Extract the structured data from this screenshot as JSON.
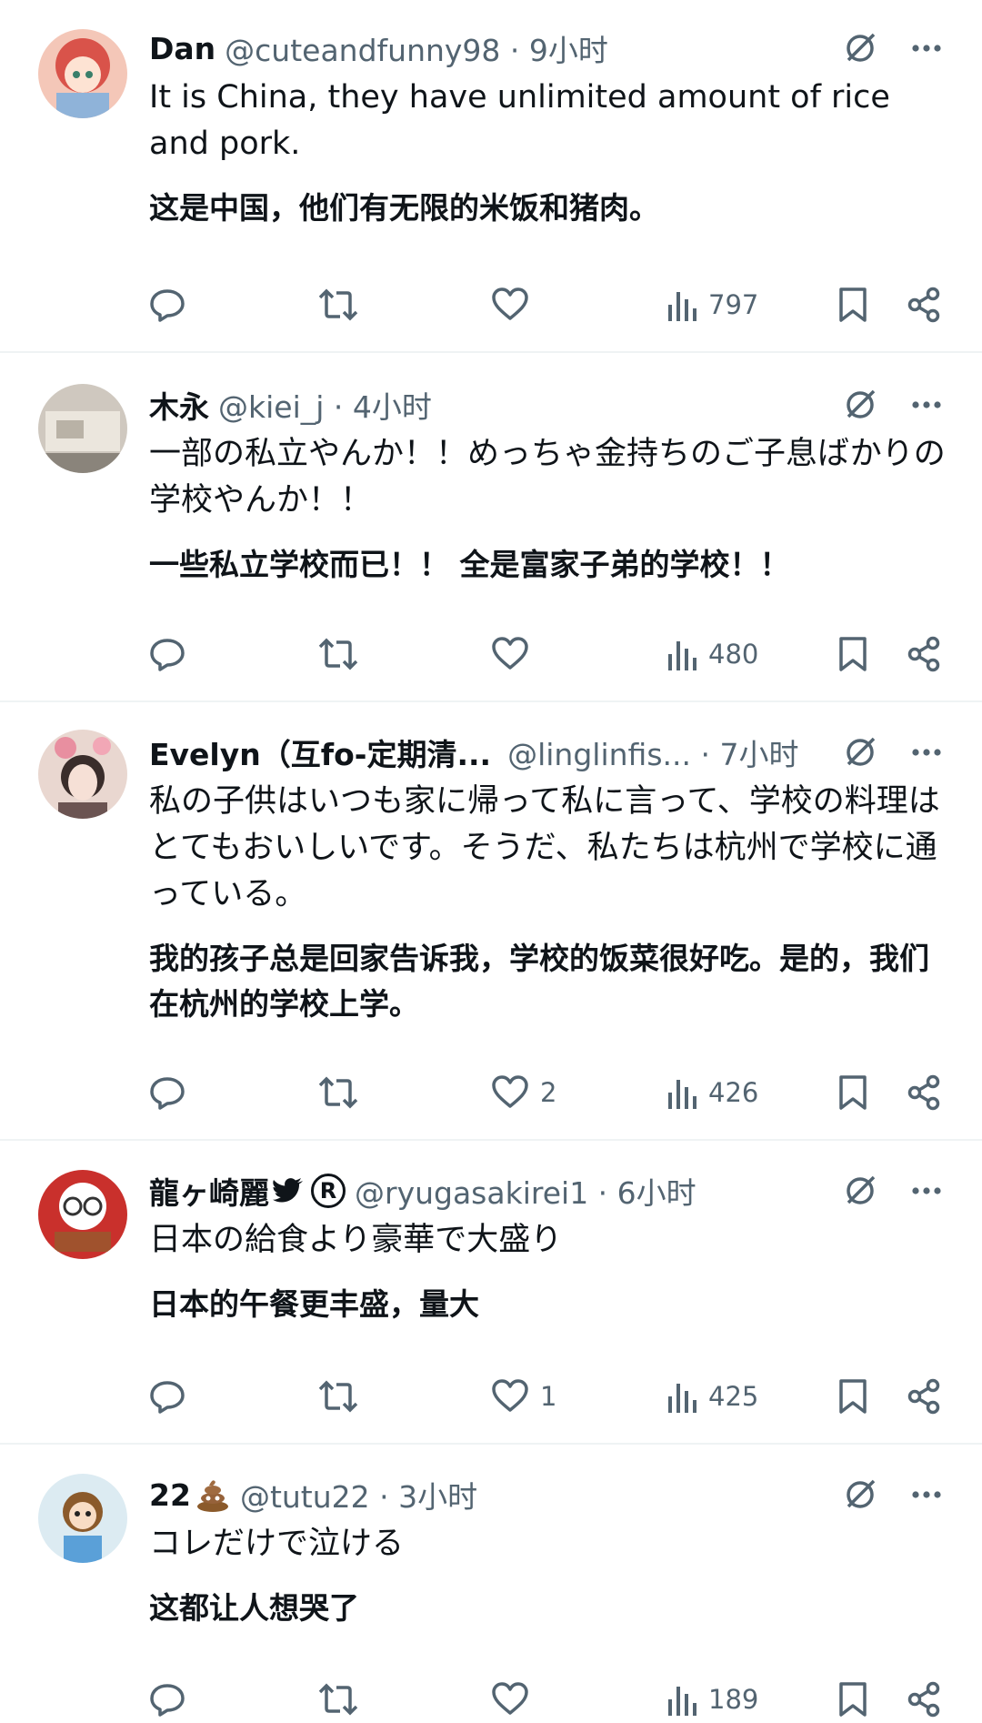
{
  "posts": [
    {
      "name": "Dan",
      "handle": "@cuteandfunny98 · 9小时",
      "text": "It is China, they have unlimited amount of rice and pork.",
      "translation": "这是中国，他们有无限的米饭和猪肉。",
      "likes": "",
      "views": "797"
    },
    {
      "name": "木永",
      "handle": "@kiei_j · 4小时",
      "text": "一部の私立やんか！！めっちゃ金持ちのご子息ばかりの学校やんか！！",
      "translation": "一些私立学校而已！！ 全是富家子弟的学校！！",
      "likes": "",
      "views": "480"
    },
    {
      "name": "Evelyn（互fo-定期清...",
      "handle": "@linglinfis... · 7小时",
      "text": "私の子供はいつも家に帰って私に言って、学校の料理はとてもおいしいです。そうだ、私たちは杭州で学校に通っている。",
      "translation": "我的孩子总是回家告诉我，学校的饭菜很好吃。是的，我们在杭州的学校上学。",
      "likes": "2",
      "views": "426"
    },
    {
      "name": "龍ヶ崎麗",
      "handle": "@ryugasakirei1 · 6小时",
      "text": "日本の給食より豪華で大盛り",
      "translation": "日本的午餐更丰盛，量大",
      "likes": "1",
      "views": "425"
    },
    {
      "name": "22",
      "handle": "@tutu22 · 3小时",
      "text": "コレだけで泣ける",
      "translation": "这都让人想哭了",
      "likes": "",
      "views": "189"
    }
  ],
  "colors": {
    "text": "#0f1419",
    "muted": "#536471",
    "divider": "#eff3f4"
  }
}
